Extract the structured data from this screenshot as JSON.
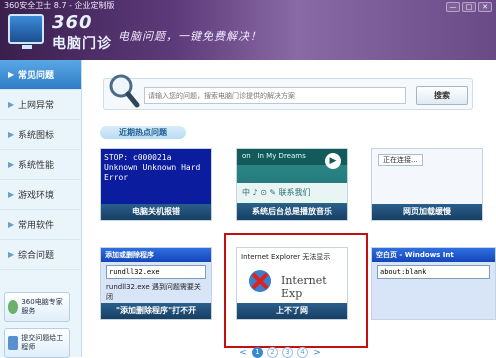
{
  "window": {
    "title": "360安全卫士 8.7 - 企业定制版",
    "logo_top": "360",
    "logo_bottom": "电脑门诊",
    "slogan": "电脑问题，一键免费解决！"
  },
  "sidebar": {
    "items": [
      {
        "label": "常见问题",
        "active": true
      },
      {
        "label": "上网异常",
        "active": false
      },
      {
        "label": "系统图标",
        "active": false
      },
      {
        "label": "系统性能",
        "active": false
      },
      {
        "label": "游戏环境",
        "active": false
      },
      {
        "label": "常用软件",
        "active": false
      },
      {
        "label": "综合问题",
        "active": false
      }
    ],
    "expert_button": "360电脑专家服务",
    "submit_button": "提交问题给工程师"
  },
  "search": {
    "placeholder": "请输入您的问题，搜索电脑门诊提供的解决方案",
    "button_label": "搜索"
  },
  "hot_section": {
    "label": "近期热点问题"
  },
  "cards": [
    {
      "caption": "电脑关机报错",
      "screen_text": "STOP: c000021a Unknown Unknown Hard Error"
    },
    {
      "caption": "系统后台总是播放音乐",
      "screen_title": "In My Dreams",
      "screen_tab": "on",
      "screen_bar": "中 ♪ ⊙ ✎ 联系我们"
    },
    {
      "caption": "网页加载缓慢",
      "screen_text": "正在连接..."
    },
    {
      "caption": "\"添加删除程序\"打不开",
      "window_title": "添加或删除程序",
      "line1": "rundll32.exe",
      "line2": "rundll32.exe 遇到问题需要关闭"
    },
    {
      "caption": "上不了网",
      "window_title": "Internet Explorer 无法显示",
      "body_text": "Internet Exp"
    },
    {
      "caption": "",
      "window_title": "空白页 - Windows Int",
      "address": "about:blank"
    }
  ],
  "pager": {
    "prev": "<",
    "next": ">",
    "pages": [
      "1",
      "2",
      "3",
      "4"
    ],
    "current": 0
  },
  "colors": {
    "titlebar": "#5d3a7a",
    "sidebar_active": "#2f7cc6",
    "card_label": "#1e4c74",
    "highlight": "#c40f0f"
  }
}
